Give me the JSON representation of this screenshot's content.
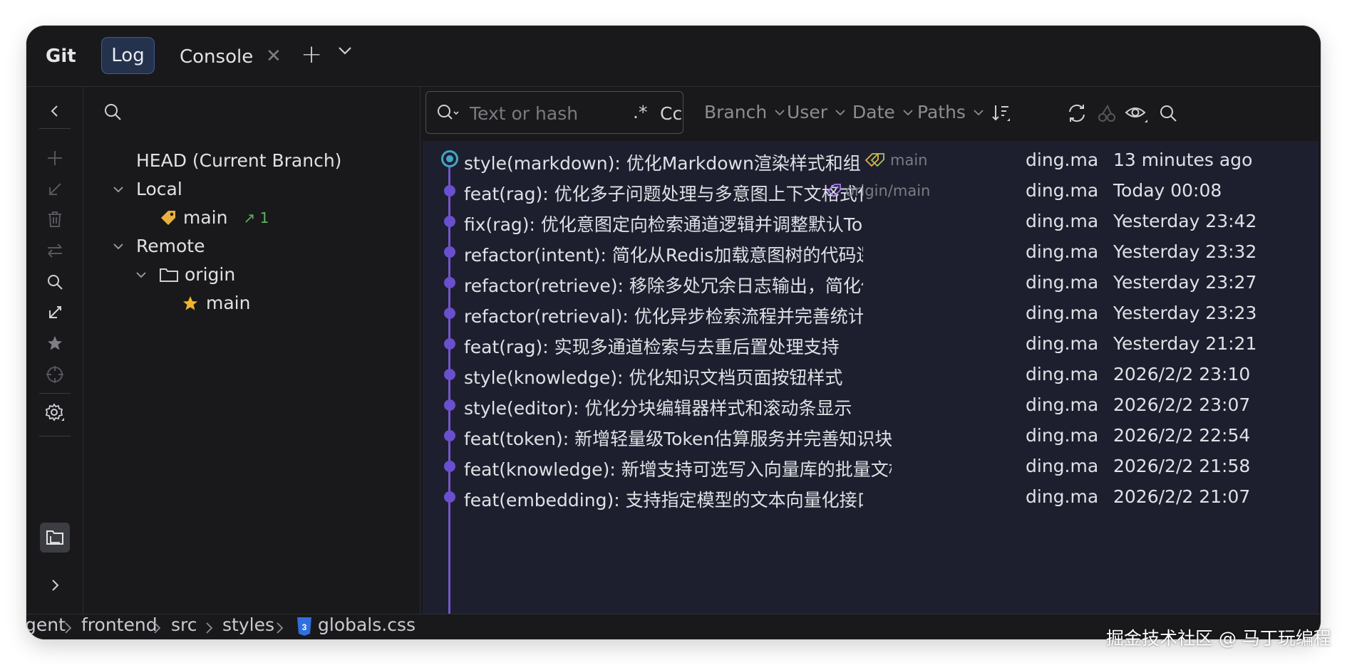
{
  "tabs": {
    "git": "Git",
    "log": "Log",
    "console": "Console"
  },
  "tree": {
    "head": "HEAD (Current Branch)",
    "local": "Local",
    "local_branch": "main",
    "local_ahead": "1",
    "remote": "Remote",
    "origin": "origin",
    "remote_branch": "main"
  },
  "search": {
    "placeholder": "Text or hash",
    "regex_label": ".*",
    "case_label": "Cc"
  },
  "filters": {
    "branch": "Branch",
    "user": "User",
    "date": "Date",
    "paths": "Paths"
  },
  "commits": [
    {
      "message": "style(markdown): 优化Markdown渲染样式和组件交互体验",
      "ref": "main",
      "author": "ding.ma",
      "date": "13 minutes ago"
    },
    {
      "message": "feat(rag): 优化多子问题处理与多意图上下文格式化",
      "ref": "origin/main",
      "author": "ding.ma",
      "date": "Today 00:08"
    },
    {
      "message": "fix(rag): 优化意图定向检索通道逻辑并调整默认TopK值",
      "ref": "",
      "author": "ding.ma",
      "date": "Yesterday 23:42"
    },
    {
      "message": "refactor(intent): 简化从Redis加载意图树的代码逻辑",
      "ref": "",
      "author": "ding.ma",
      "date": "Yesterday 23:32"
    },
    {
      "message": "refactor(retrieve): 移除多处冗余日志输出，简化代码",
      "ref": "",
      "author": "ding.ma",
      "date": "Yesterday 23:27"
    },
    {
      "message": "refactor(retrieval): 优化异步检索流程并完善统计日志",
      "ref": "",
      "author": "ding.ma",
      "date": "Yesterday 23:23"
    },
    {
      "message": "feat(rag): 实现多通道检索与去重后置处理支持",
      "ref": "",
      "author": "ding.ma",
      "date": "Yesterday 21:21"
    },
    {
      "message": "style(knowledge): 优化知识文档页面按钮样式",
      "ref": "",
      "author": "ding.ma",
      "date": "2026/2/2 23:10"
    },
    {
      "message": "style(editor): 优化分块编辑器样式和滚动条显示",
      "ref": "",
      "author": "ding.ma",
      "date": "2026/2/2 23:07"
    },
    {
      "message": "feat(token): 新增轻量级Token估算服务并完善知识块Token统计",
      "ref": "",
      "author": "ding.ma",
      "date": "2026/2/2 22:54"
    },
    {
      "message": "feat(knowledge): 新增支持可选写入向量库的批量文档分片接口",
      "ref": "",
      "author": "ding.ma",
      "date": "2026/2/2 21:58"
    },
    {
      "message": "feat(embedding): 支持指定模型的文本向量化接口",
      "ref": "",
      "author": "ding.ma",
      "date": "2026/2/2 21:07"
    }
  ],
  "breadcrumb": {
    "project": "gent",
    "folder1": "frontend",
    "folder2": "src",
    "folder3": "styles",
    "file": "globals.css"
  },
  "watermark": "掘金技术社区 @ 马丁玩编程",
  "colors": {
    "accent": "#3d5a96",
    "graph": "#6a4fd0",
    "head_node": "#42a5c6",
    "tag_local": "#e8b13d",
    "tag_remote": "#a67cf0",
    "ahead": "#5fb25f",
    "css_icon": "#2f6fe0"
  }
}
